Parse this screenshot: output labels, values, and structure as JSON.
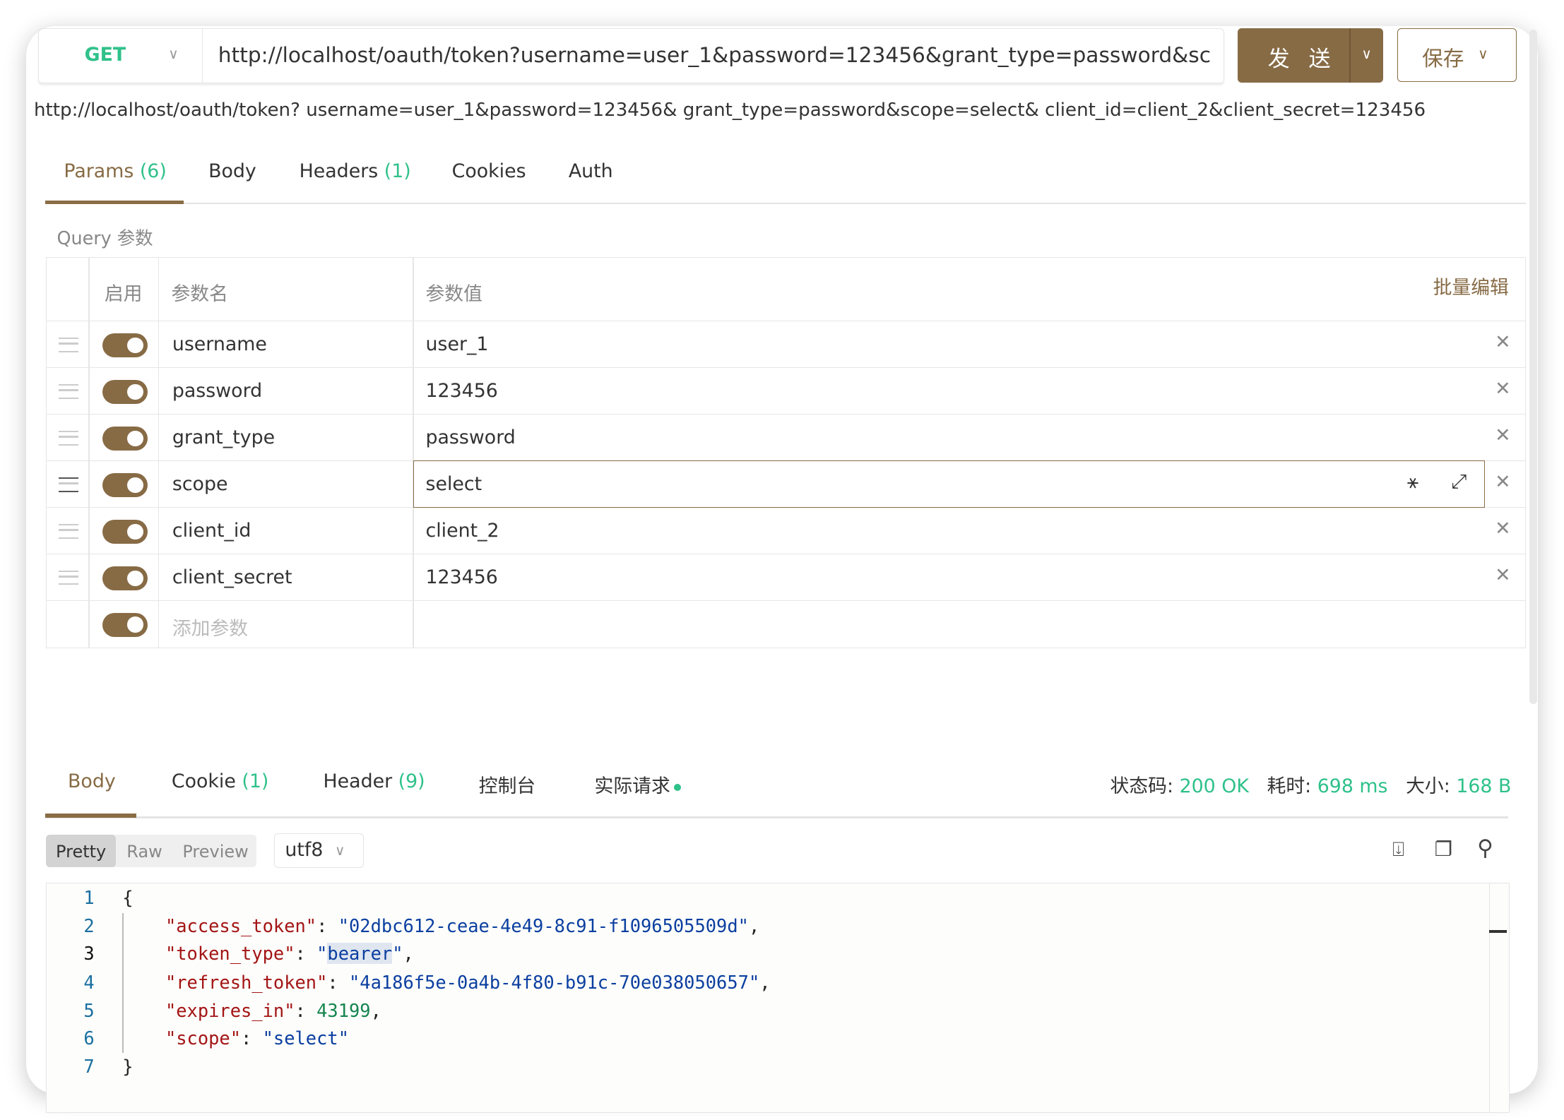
{
  "request": {
    "method": "GET",
    "url": "http://localhost/oauth/token?username=user_1&password=123456&grant_type=password&scope=select&client_id=client_2&client_secret=123456",
    "send_label": "发 送",
    "save_label": "保存",
    "full_url": "http://localhost/oauth/token? username=user_1&password=123456& grant_type=password&scope=select& client_id=client_2&client_secret=123456"
  },
  "req_tabs": [
    {
      "label": "Params",
      "count": "(6)"
    },
    {
      "label": "Body",
      "count": ""
    },
    {
      "label": "Headers",
      "count": "(1)"
    },
    {
      "label": "Cookies",
      "count": ""
    },
    {
      "label": "Auth",
      "count": ""
    }
  ],
  "query": {
    "title": "Query 参数",
    "col_enabled": "启用",
    "col_name": "参数名",
    "col_value": "参数值",
    "bulk_edit": "批量编辑",
    "add_placeholder": "添加参数",
    "params": [
      {
        "name": "username",
        "value": "user_1",
        "enabled": true
      },
      {
        "name": "password",
        "value": "123456",
        "enabled": true
      },
      {
        "name": "grant_type",
        "value": "password",
        "enabled": true
      },
      {
        "name": "scope",
        "value": "select",
        "enabled": true
      },
      {
        "name": "client_id",
        "value": "client_2",
        "enabled": true
      },
      {
        "name": "client_secret",
        "value": "123456",
        "enabled": true
      }
    ]
  },
  "resp_tabs": [
    {
      "label": "Body",
      "count": ""
    },
    {
      "label": "Cookie",
      "count": "(1)"
    },
    {
      "label": "Header",
      "count": "(9)"
    },
    {
      "label": "控制台",
      "count": ""
    },
    {
      "label": "实际请求",
      "count": ""
    }
  ],
  "status": {
    "code_label": "状态码:",
    "code": "200 OK",
    "time_label": "耗时:",
    "time": "698 ms",
    "size_label": "大小:",
    "size": "168 B"
  },
  "view": {
    "modes": [
      "Pretty",
      "Raw",
      "Preview"
    ],
    "encoding": "utf8"
  },
  "body_lines": [
    "1",
    "2",
    "3",
    "4",
    "5",
    "6",
    "7"
  ],
  "json": {
    "access_token_key": "\"access_token\"",
    "access_token": "\"02dbc612-ceae-4e49-8c91-f1096505509d\"",
    "token_type_key": "\"token_type\"",
    "token_type": "bearer",
    "refresh_token_key": "\"refresh_token\"",
    "refresh_token": "\"4a186f5e-0a4b-4f80-b91c-70e038050657\"",
    "expires_in_key": "\"expires_in\"",
    "expires_in": "43199",
    "scope_key": "\"scope\"",
    "scope": "\"select\""
  },
  "colors": {
    "accent": "#876b45",
    "green": "#2fc18a"
  }
}
